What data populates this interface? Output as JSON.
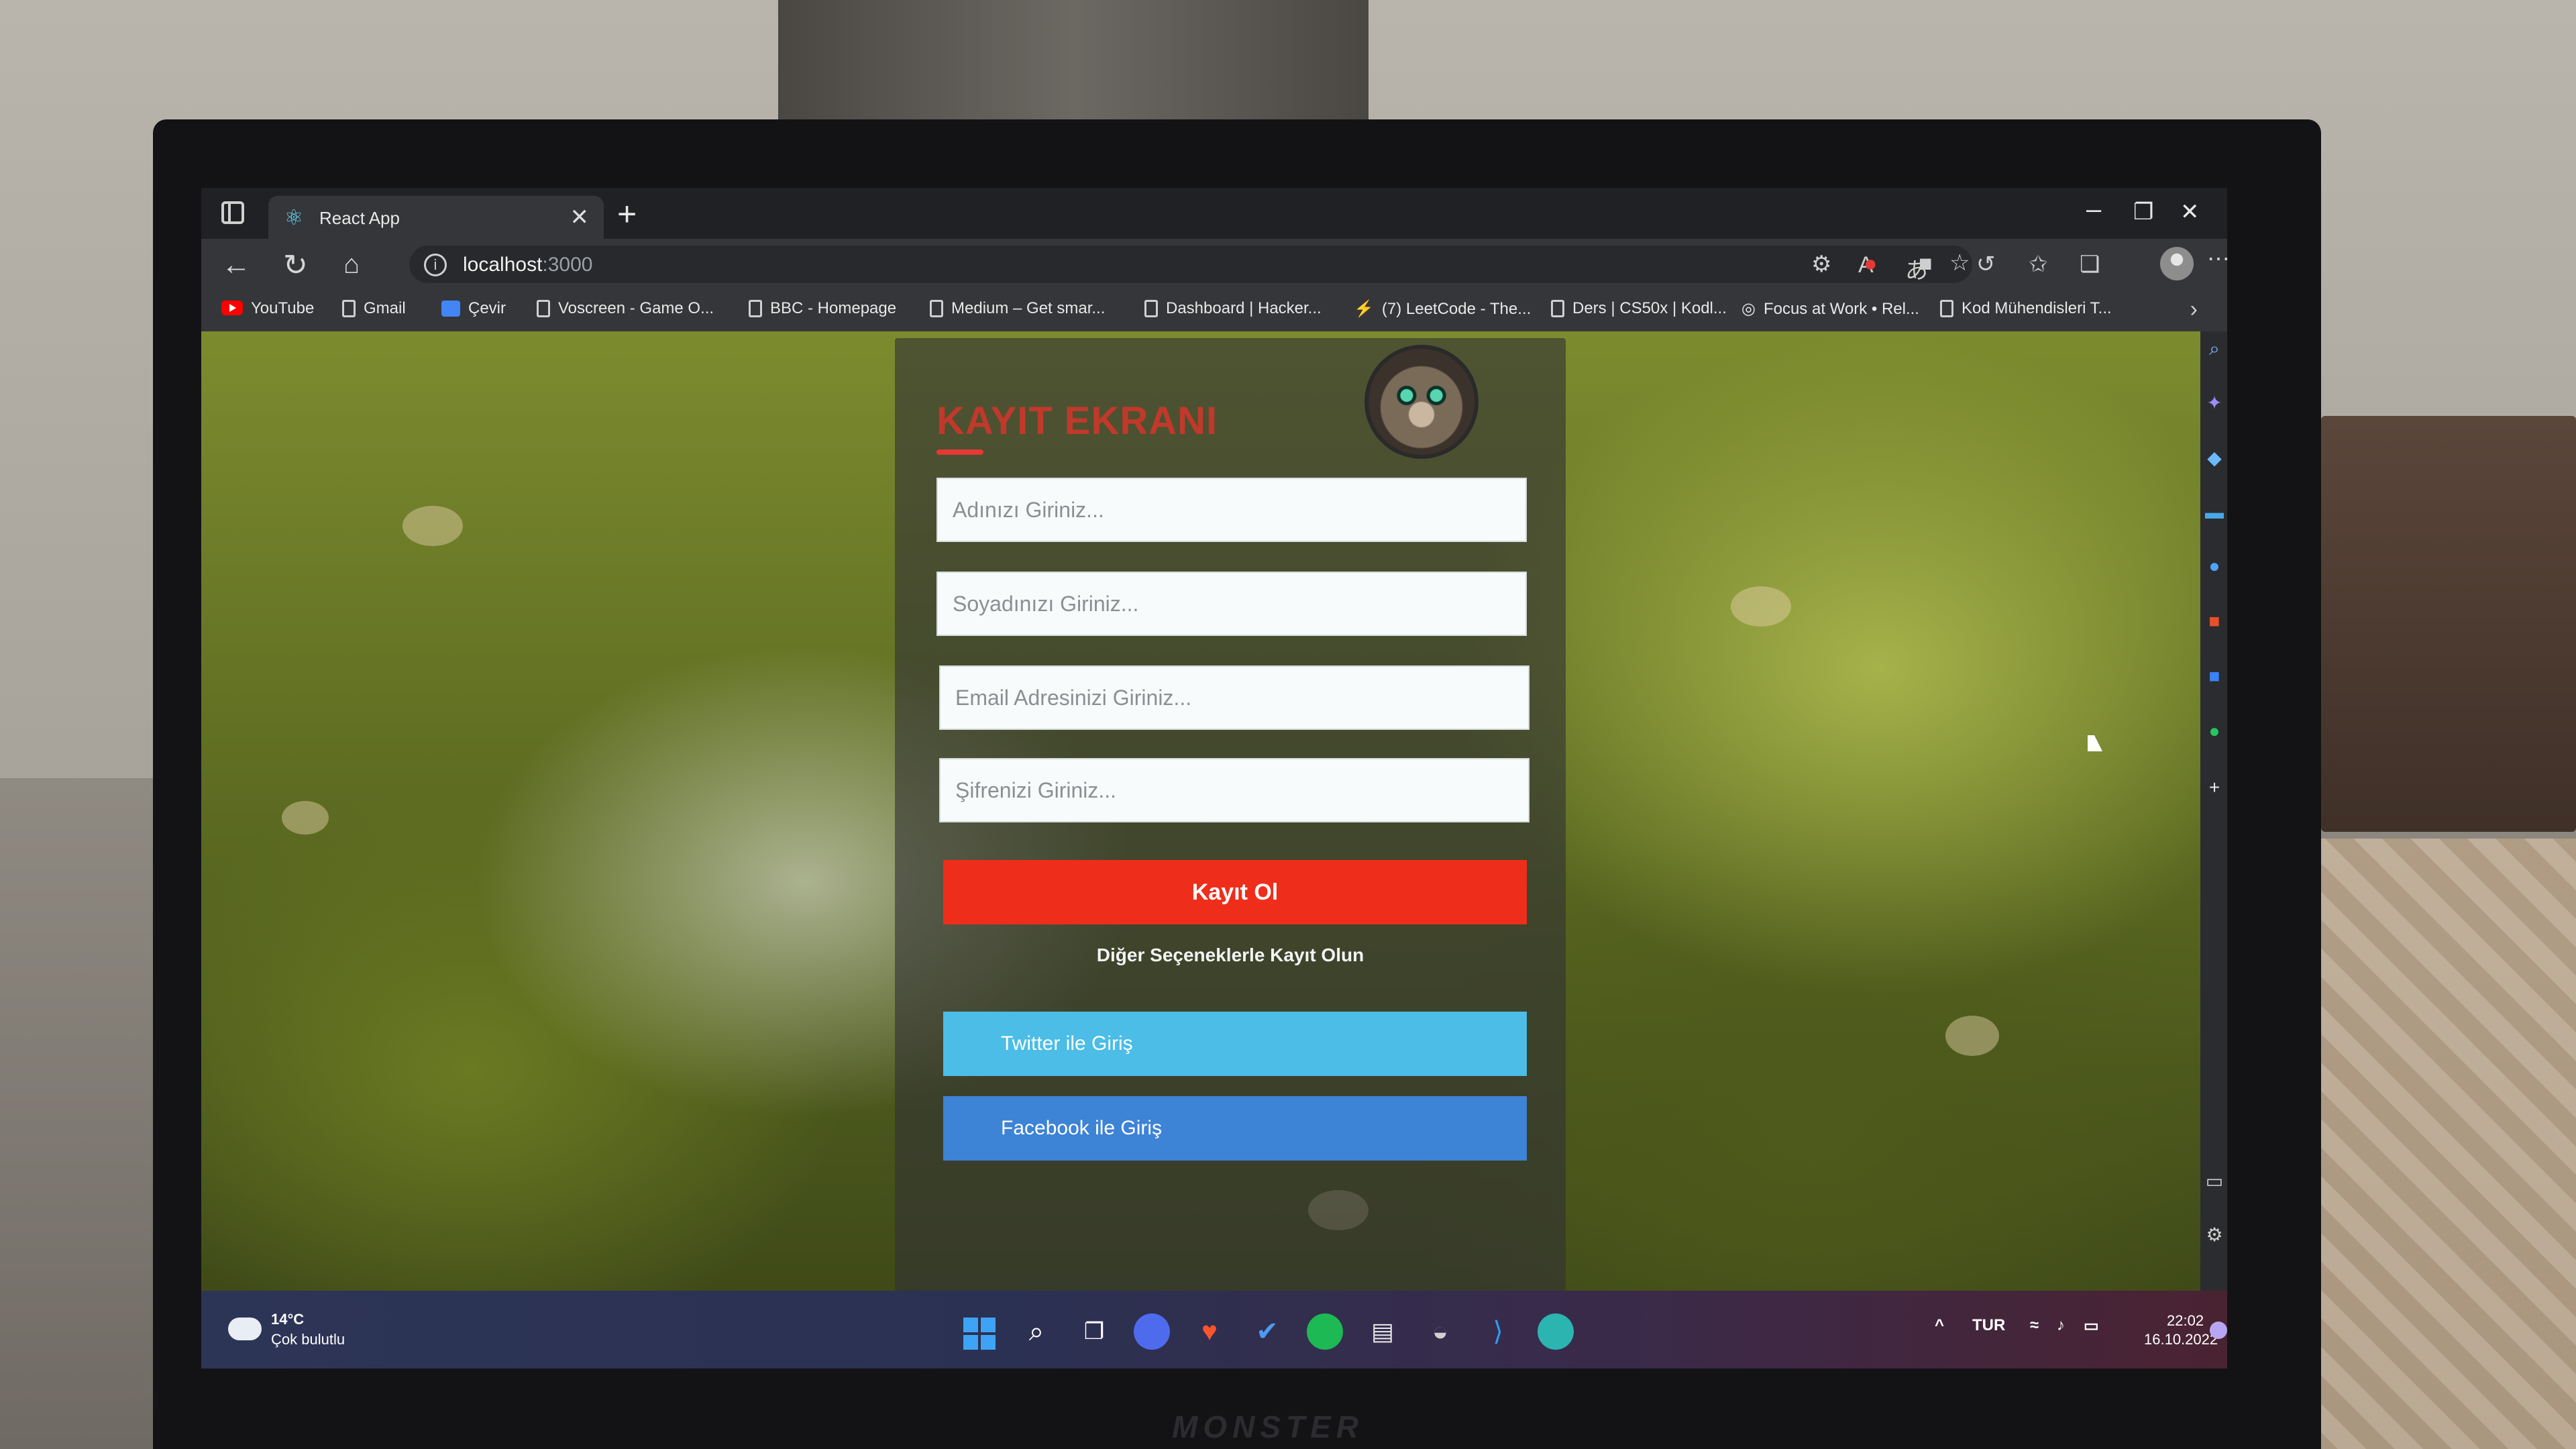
{
  "browser": {
    "tab_title": "React App",
    "url_host": "localhost",
    "url_port": ":3000",
    "window_controls": {
      "minimize": "–",
      "restore": "❐",
      "close": "✕"
    }
  },
  "bookmarks": [
    {
      "label": "YouTube",
      "icon": "youtube-icon"
    },
    {
      "label": "Gmail",
      "icon": "page-icon"
    },
    {
      "label": "Çevir",
      "icon": "translate-icon"
    },
    {
      "label": "Voscreen - Game O...",
      "icon": "page-icon"
    },
    {
      "label": "BBC - Homepage",
      "icon": "page-icon"
    },
    {
      "label": "Medium – Get smar...",
      "icon": "page-icon"
    },
    {
      "label": "Dashboard | Hacker...",
      "icon": "page-icon"
    },
    {
      "label": "(7) LeetCode - The...",
      "icon": "leetcode-icon"
    },
    {
      "label": "Ders | CS50x | Kodl...",
      "icon": "page-icon"
    },
    {
      "label": "Focus at Work • Rel...",
      "icon": "focus-icon"
    },
    {
      "label": "Kod Mühendisleri T...",
      "icon": "page-icon"
    }
  ],
  "form": {
    "title": "KAYIT EKRANI",
    "first_name_placeholder": "Adınızı Giriniz...",
    "last_name_placeholder": "Soyadınızı Giriniz...",
    "email_placeholder": "Email Adresinizi Giriniz...",
    "password_placeholder": "Şifrenizi Giriniz...",
    "register_label": "Kayıt Ol",
    "other_options": "Diğer Seçeneklerle Kayıt Olun",
    "twitter_label": "Twitter ile Giriş",
    "facebook_label": "Facebook ile Giriş"
  },
  "taskbar": {
    "weather_temp": "14°C",
    "weather_desc": "Çok bulutlu",
    "language": "TUR",
    "time": "22:02",
    "date": "16.10.2022"
  },
  "colors": {
    "register_button": "#ef2d1b",
    "twitter_button": "#4bbde6",
    "facebook_button": "#3d83d6",
    "title": "#c0392b"
  }
}
